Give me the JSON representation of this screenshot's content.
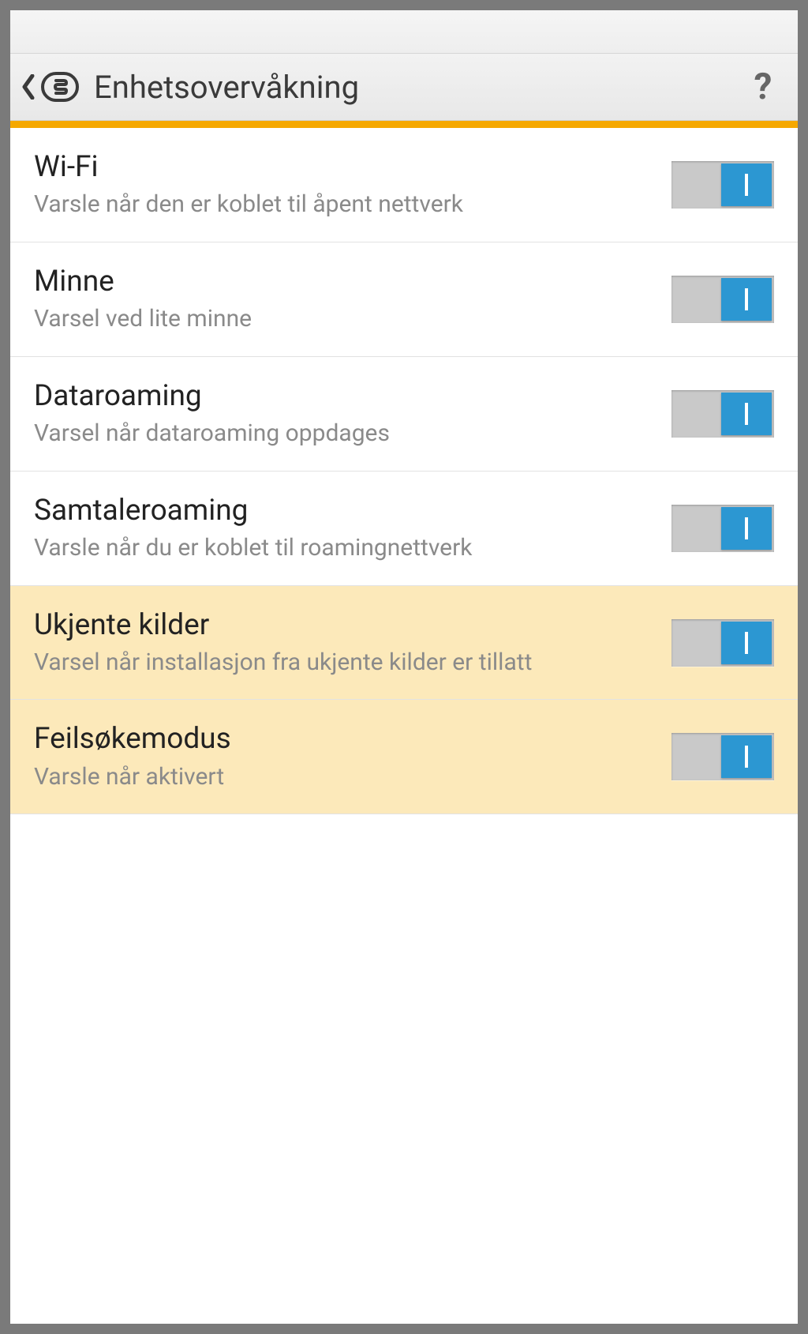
{
  "header": {
    "title": "Enhetsovervåkning"
  },
  "settings": [
    {
      "title": "Wi-Fi",
      "desc": "Varsle når den er koblet til åpent nettverk",
      "on": true,
      "highlighted": false
    },
    {
      "title": "Minne",
      "desc": "Varsel ved lite minne",
      "on": true,
      "highlighted": false
    },
    {
      "title": "Dataroaming",
      "desc": "Varsel når dataroaming oppdages",
      "on": true,
      "highlighted": false
    },
    {
      "title": "Samtaleroaming",
      "desc": "Varsle når du er koblet til roamingnettverk",
      "on": true,
      "highlighted": false
    },
    {
      "title": "Ukjente kilder",
      "desc": "Varsel når installasjon fra ukjente kilder er tillatt",
      "on": true,
      "highlighted": true
    },
    {
      "title": "Feilsøkemodus",
      "desc": "Varsle når aktivert",
      "on": true,
      "highlighted": true
    }
  ]
}
